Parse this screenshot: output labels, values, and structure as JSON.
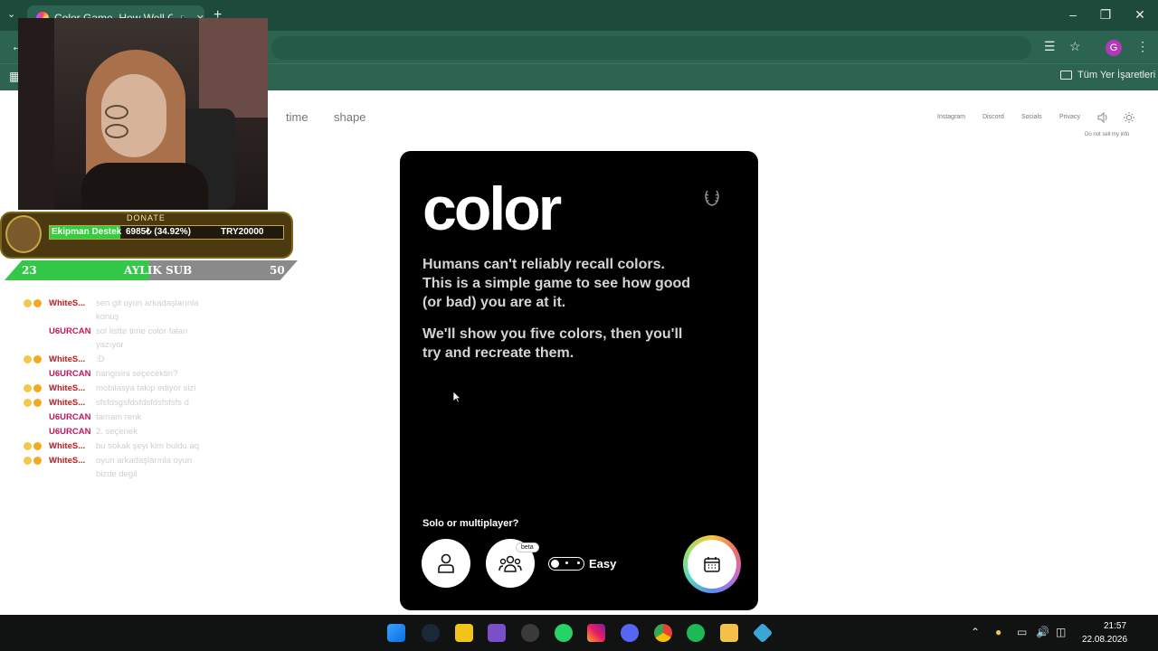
{
  "browser": {
    "tab_title": "Color Game. How Well Can",
    "new_tab": "+",
    "bookmarks_all": "Tüm Yer İşaretleri",
    "profile_initial": "G"
  },
  "overlay": {
    "donate_label": "DONATE",
    "donate_name": "Ekipman Destek",
    "donate_progress_text": "6985₺ (34.92%)",
    "donate_progress_fraction": 0.3492,
    "donate_goal": "TRY20000",
    "sub_current": "23",
    "sub_label": "AYLIK SUB",
    "sub_goal": "50",
    "sub_fraction": 0.46
  },
  "chat": [
    {
      "user": "WhiteS...",
      "color": "#c41a1a",
      "badges": true,
      "msg": "sen git oyun arkadaşlarınla konuş"
    },
    {
      "user": "U6URCAN",
      "color": "#c2185b",
      "badges": false,
      "msg": "sol listte time color falan yazıyor"
    },
    {
      "user": "WhiteS...",
      "color": "#c41a1a",
      "badges": true,
      "msg": ":D"
    },
    {
      "user": "U6URCAN",
      "color": "#c2185b",
      "badges": false,
      "msg": "hangisini seçecektin?"
    },
    {
      "user": "WhiteS...",
      "color": "#c41a1a",
      "badges": true,
      "msg": "mobilasya takip ediyor sizi"
    },
    {
      "user": "WhiteS...",
      "color": "#c41a1a",
      "badges": true,
      "msg": "sfsfdsgsfdsfdsfdsfsfsfs d"
    },
    {
      "user": "U6URCAN",
      "color": "#c2185b",
      "badges": false,
      "msg": "tamam renk"
    },
    {
      "user": "U6URCAN",
      "color": "#c2185b",
      "badges": false,
      "msg": "2. seçenek"
    },
    {
      "user": "WhiteS...",
      "color": "#c41a1a",
      "badges": true,
      "msg": "bu sokak şeyi kim buldu aq"
    },
    {
      "user": "WhiteS...",
      "color": "#c41a1a",
      "badges": true,
      "msg": "oyun arkadaşlarınla oyun bizde degil"
    }
  ],
  "page": {
    "nav_time": "time",
    "nav_shape": "shape",
    "nav_instagram": "Instagram",
    "nav_discord": "Discord",
    "nav_socials": "Socials",
    "nav_privacy": "Privacy",
    "do_not_sell": "Do not sell my info"
  },
  "card": {
    "title": "color",
    "paragraph1": "Humans can't reliably recall colors. This is a simple game to see how good (or bad) you are at it.",
    "paragraph2": "We'll show you five colors, then you'll try and recreate them.",
    "mode_question": "Solo or multiplayer?",
    "beta": "beta",
    "difficulty": "Easy"
  },
  "taskbar": {
    "time": "21:57",
    "date": "22.08.2026"
  },
  "colors": {
    "browser_bg": "#2d6451",
    "card_bg": "#000000",
    "donate_green": "#2fd03a"
  }
}
